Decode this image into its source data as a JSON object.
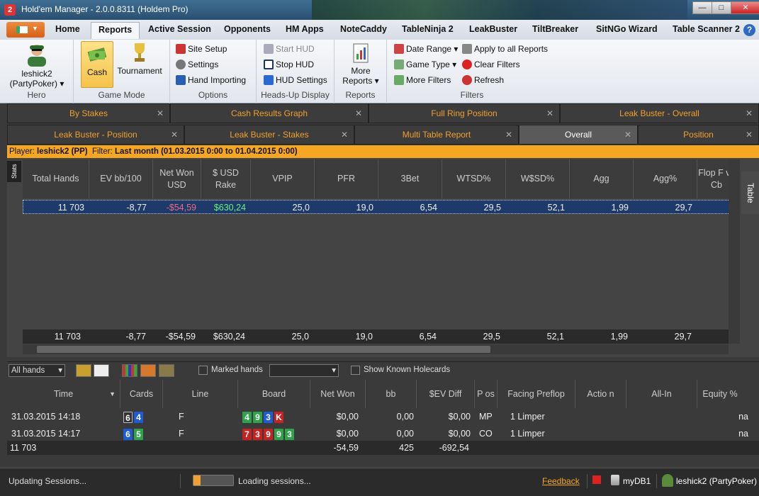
{
  "window": {
    "title": "Hold'em Manager - 2.0.0.8311 (Holdem Pro)",
    "app_icon_text": "2",
    "minimize": "—",
    "maximize": "□",
    "close": "✕"
  },
  "ribbon_tabs": [
    {
      "label": "Home"
    },
    {
      "label": "Reports"
    },
    {
      "label": "Active Session"
    },
    {
      "label": "Opponents"
    },
    {
      "label": "HM Apps"
    },
    {
      "label": "NoteCaddy"
    },
    {
      "label": "TableNinja 2"
    },
    {
      "label": "LeakBuster"
    },
    {
      "label": "TiltBreaker"
    },
    {
      "label": "SitNGo Wizard"
    },
    {
      "label": "Table Scanner 2"
    }
  ],
  "help_label": "?",
  "ribbon": {
    "hero": {
      "name": "leshick2",
      "site": "(PartyPoker)",
      "dropdown": "▾",
      "group_label": "Hero"
    },
    "game_mode": {
      "cash": "Cash",
      "tournament": "Tournament",
      "group_label": "Game Mode"
    },
    "options": {
      "site_setup": "Site Setup",
      "settings": "Settings",
      "hand_importing": "Hand Importing",
      "group_label": "Options"
    },
    "hud": {
      "start": "Start HUD",
      "stop": "Stop HUD",
      "settings": "HUD Settings",
      "group_label": "Heads-Up Display"
    },
    "reports": {
      "more_line1": "More",
      "more_line2": "Reports",
      "dropdown": "▾",
      "group_label": "Reports"
    },
    "filters": {
      "date_range": "Date Range",
      "game_type": "Game Type",
      "more_filters": "More Filters",
      "apply_all": "Apply to all Reports",
      "clear": "Clear Filters",
      "refresh": "Refresh",
      "dropdown": "▾",
      "group_label": "Filters"
    }
  },
  "doc_tabs_row1": [
    {
      "label": "By Stakes"
    },
    {
      "label": "Cash Results Graph"
    },
    {
      "label": "Full Ring Position"
    },
    {
      "label": "Leak Buster - Overall"
    }
  ],
  "doc_tabs_row2": [
    {
      "label": "Leak Buster - Position"
    },
    {
      "label": "Leak Buster - Stakes"
    },
    {
      "label": "Multi Table Report"
    },
    {
      "label": "Overall"
    },
    {
      "label": "Position"
    }
  ],
  "tab_close": "✕",
  "filterbar": {
    "player_label": "Player:",
    "player_value": "leshick2 (PP)",
    "filter_label": "Filter:",
    "filter_value": "Last month (01.03.2015 0:00 to 01.04.2015 0:00)"
  },
  "stats_side_label": "Stats",
  "table_side_label": "Table",
  "stats_columns": [
    "Total Hands",
    "EV bb/100",
    "Net Won USD",
    "$ USD Rake",
    "VPIP",
    "PFR",
    "3Bet",
    "WTSD%",
    "W$SD%",
    "Agg",
    "Agg%",
    "Flop F vs Cb"
  ],
  "stats_row": {
    "total_hands": "11 703",
    "ev_bb100": "-8,77",
    "net_won": "-$54,59",
    "rake": "$630,24",
    "vpip": "25,0",
    "pfr": "19,0",
    "threebet": "6,54",
    "wtsd": "29,5",
    "wsd": "52,1",
    "agg": "1,99",
    "aggpct": "29,7"
  },
  "stats_total": {
    "total_hands": "11 703",
    "ev_bb100": "-8,77",
    "net_won": "-$54,59",
    "rake": "$630,24",
    "vpip": "25,0",
    "pfr": "19,0",
    "threebet": "6,54",
    "wtsd": "29,5",
    "wsd": "52,1",
    "agg": "1,99",
    "aggpct": "29,7"
  },
  "hands_toolbar": {
    "all_hands": "All hands",
    "marked_hands": "Marked hands",
    "show_holecards": "Show Known Holecards",
    "dropdown": "▾"
  },
  "hands_columns": [
    "Time",
    "Cards",
    "Line",
    "Board",
    "Net Won",
    "bb",
    "$EV Diff",
    "P os",
    "Facing Preflop",
    "Actio n",
    "All-In",
    "Equity %"
  ],
  "hands_rows": [
    {
      "time": "31.03.2015 14:18",
      "cards": [
        {
          "r": "6",
          "c": "k"
        },
        {
          "r": "4",
          "c": "b"
        }
      ],
      "line": "F",
      "board": [
        {
          "r": "4",
          "c": "g"
        },
        {
          "r": "9",
          "c": "g"
        },
        {
          "r": "3",
          "c": "b"
        },
        {
          "r": "K",
          "c": "r"
        }
      ],
      "net_won": "$0,00",
      "bb": "0,00",
      "ev_diff": "$0,00",
      "pos": "MP",
      "facing": "1 Limper",
      "action": "",
      "allin": "",
      "equity": "na"
    },
    {
      "time": "31.03.2015 14:17",
      "cards": [
        {
          "r": "6",
          "c": "b"
        },
        {
          "r": "5",
          "c": "g"
        }
      ],
      "line": "F",
      "board": [
        {
          "r": "7",
          "c": "r"
        },
        {
          "r": "3",
          "c": "r"
        },
        {
          "r": "9",
          "c": "r"
        },
        {
          "r": "9",
          "c": "g"
        },
        {
          "r": "3",
          "c": "g"
        }
      ],
      "net_won": "$0,00",
      "bb": "0,00",
      "ev_diff": "$0,00",
      "pos": "CO",
      "facing": "1 Limper",
      "action": "",
      "allin": "",
      "equity": "na"
    }
  ],
  "hands_total": {
    "count": "11 703",
    "net_won": "-54,59",
    "bb": "425",
    "ev_diff": "-692,54"
  },
  "statusbar": {
    "left": "Updating Sessions...",
    "loading": "Loading sessions...",
    "feedback": "Feedback",
    "db": "myDB1",
    "user": "leshick2 (PartyPoker)"
  }
}
